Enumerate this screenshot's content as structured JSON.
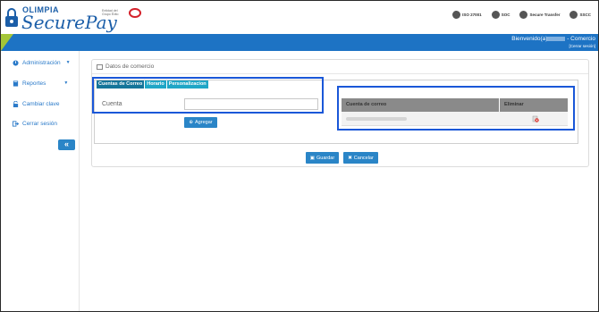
{
  "brand": {
    "small": "OLIMPIA",
    "big": "SecurePay"
  },
  "partner": {
    "text": "Entidad del Grupo Éxito"
  },
  "certs": [
    "ISO 27001",
    "SOC",
    "Secure Transfer",
    "SSCC"
  ],
  "header": {
    "welcome_prefix": "Bienvenido(a)",
    "welcome_suffix": "- Comercio",
    "logout": "[Cerrar sesión]"
  },
  "sidebar": {
    "items": [
      {
        "label": "Administración",
        "has_caret": true
      },
      {
        "label": "Reportes",
        "has_caret": true
      },
      {
        "label": "Cambiar clave",
        "has_caret": false
      },
      {
        "label": "Cerrar sesión",
        "has_caret": false
      }
    ],
    "collapse_label": "«"
  },
  "panel": {
    "title": "Datos de comercio",
    "tabs": [
      {
        "label": "Cuentas de Correo",
        "active": true
      },
      {
        "label": "Horario",
        "active": false
      },
      {
        "label": "Personalizacion",
        "active": false
      }
    ],
    "cuenta_label": "Cuenta",
    "cuenta_value": "",
    "agregar_label": "Agregar",
    "table": {
      "headers": [
        "Cuenta de correo",
        "Eliminar"
      ]
    },
    "guardar_label": "Guardar",
    "cancelar_label": "Cancelar"
  },
  "colors": {
    "primary": "#1d73c4",
    "accent_green": "#a4c639",
    "tab": "#1fa6c6",
    "highlight": "#1a57d8"
  }
}
